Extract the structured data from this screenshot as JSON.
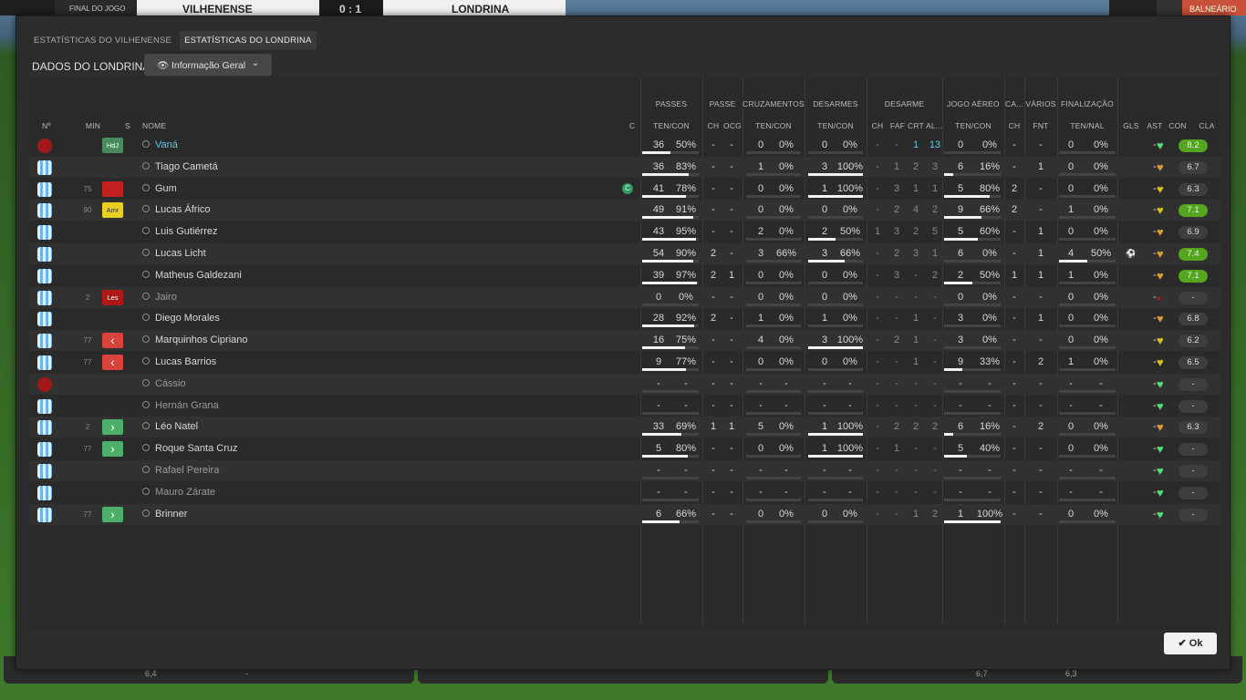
{
  "topbar": {
    "final_label": "FINAL DO JOGO",
    "home": "VILHENENSE",
    "score": "0 : 1",
    "away": "LONDRINA",
    "right_label": "BALNEÁRIO"
  },
  "tabs": [
    {
      "label": "ESTATÍSTICAS DO VILHENENSE",
      "active": false
    },
    {
      "label": "ESTATÍSTICAS DO LONDRINA",
      "active": true
    }
  ],
  "section_title": "DADOS DO LONDRINA",
  "view_dropdown": {
    "value": "Informação Geral",
    "icon": "eye-icon"
  },
  "group_headers": [
    "PASSES",
    "PASSE",
    "CRUZAMENTOS",
    "DESARMES",
    "DESARME",
    "JOGO AÉREO",
    "CA...",
    "VÁRIOS",
    "FINALIZAÇÃO"
  ],
  "columns": [
    "Nº",
    "MIN",
    "S",
    "NOME",
    "C",
    "TEN/CON",
    "CH",
    "OCG",
    "TEN/CON",
    "TEN/CON",
    "CH",
    "FAF",
    "CRT",
    "AL...",
    "TEN/CON",
    "CH",
    "FNT",
    "TEN/NAL",
    "GLS",
    "AST",
    "CON",
    "CLA"
  ],
  "players": [
    {
      "shirt": "red",
      "min": "",
      "status": "HdJ",
      "status_color": "#4a8a5c",
      "name": "Vaná",
      "captain": false,
      "pass": [
        "36",
        "50%"
      ],
      "passe": [
        "-",
        "-"
      ],
      "cruz": [
        "0",
        "0%"
      ],
      "des": [
        "0",
        "0%"
      ],
      "desarme": [
        "-",
        "-",
        "1",
        "13"
      ],
      "aereo": [
        "0",
        "0%"
      ],
      "ca": "-",
      "fnt": "-",
      "fin": [
        "0",
        "0%"
      ],
      "gls": "",
      "ast": "-",
      "heart": "green",
      "rating": "8.2",
      "good": true,
      "pbar": 50,
      "dbar": 0,
      "abar": 0,
      "fbar": 0
    },
    {
      "shirt": "blue",
      "min": "",
      "status": "",
      "status_color": "",
      "name": "Tiago Cametá",
      "captain": false,
      "pass": [
        "36",
        "83%"
      ],
      "passe": [
        "-",
        "-"
      ],
      "cruz": [
        "1",
        "0%"
      ],
      "des": [
        "3",
        "100%"
      ],
      "desarme": [
        "-",
        "1",
        "2",
        "3"
      ],
      "aereo": [
        "6",
        "16%"
      ],
      "ca": "-",
      "fnt": "1",
      "fin": [
        "0",
        "0%"
      ],
      "gls": "",
      "ast": "-",
      "heart": "orange",
      "rating": "6.7",
      "good": false,
      "pbar": 83,
      "dbar": 100,
      "abar": 16,
      "fbar": 0
    },
    {
      "shirt": "blue",
      "min": "75",
      "status": "",
      "status_color": "#c02020",
      "name": "Gum",
      "captain": true,
      "pass": [
        "41",
        "78%"
      ],
      "passe": [
        "-",
        "-"
      ],
      "cruz": [
        "0",
        "0%"
      ],
      "des": [
        "1",
        "100%"
      ],
      "desarme": [
        "-",
        "3",
        "1",
        "1"
      ],
      "aereo": [
        "5",
        "80%"
      ],
      "ca": "2",
      "fnt": "-",
      "fin": [
        "0",
        "0%"
      ],
      "gls": "",
      "ast": "-",
      "heart": "yellow",
      "rating": "6.3",
      "good": false,
      "pbar": 78,
      "dbar": 100,
      "abar": 80,
      "fbar": 0
    },
    {
      "shirt": "blue",
      "min": "90",
      "status": "Amr",
      "status_color": "#e8d020",
      "name": "Lucas Áfrico",
      "captain": false,
      "pass": [
        "49",
        "91%"
      ],
      "passe": [
        "-",
        "-"
      ],
      "cruz": [
        "0",
        "0%"
      ],
      "des": [
        "0",
        "0%"
      ],
      "desarme": [
        "-",
        "2",
        "4",
        "2"
      ],
      "aereo": [
        "9",
        "66%"
      ],
      "ca": "2",
      "fnt": "-",
      "fin": [
        "1",
        "0%"
      ],
      "gls": "",
      "ast": "-",
      "heart": "yellow",
      "rating": "7.1",
      "good": true,
      "pbar": 91,
      "dbar": 0,
      "abar": 66,
      "fbar": 0
    },
    {
      "shirt": "blue",
      "min": "",
      "status": "",
      "status_color": "",
      "name": "Luis Gutiérrez",
      "captain": false,
      "pass": [
        "43",
        "95%"
      ],
      "passe": [
        "-",
        "-"
      ],
      "cruz": [
        "2",
        "0%"
      ],
      "des": [
        "2",
        "50%"
      ],
      "desarme": [
        "1",
        "3",
        "2",
        "5"
      ],
      "aereo": [
        "5",
        "60%"
      ],
      "ca": "-",
      "fnt": "1",
      "fin": [
        "0",
        "0%"
      ],
      "gls": "",
      "ast": "-",
      "heart": "orange",
      "rating": "6.9",
      "good": false,
      "pbar": 95,
      "dbar": 50,
      "abar": 60,
      "fbar": 0
    },
    {
      "shirt": "blue",
      "min": "",
      "status": "",
      "status_color": "",
      "name": "Lucas Licht",
      "captain": false,
      "pass": [
        "54",
        "90%"
      ],
      "passe": [
        "2",
        "-"
      ],
      "cruz": [
        "3",
        "66%"
      ],
      "des": [
        "3",
        "66%"
      ],
      "desarme": [
        "-",
        "2",
        "3",
        "1"
      ],
      "aereo": [
        "6",
        "0%"
      ],
      "ca": "-",
      "fnt": "1",
      "fin": [
        "4",
        "50%"
      ],
      "gls": "ball",
      "ast": "-",
      "heart": "orange",
      "rating": "7.4",
      "good": true,
      "pbar": 90,
      "dbar": 66,
      "abar": 0,
      "fbar": 50
    },
    {
      "shirt": "blue",
      "min": "",
      "status": "",
      "status_color": "",
      "name": "Matheus Galdezani",
      "captain": false,
      "pass": [
        "39",
        "97%"
      ],
      "passe": [
        "2",
        "1"
      ],
      "cruz": [
        "0",
        "0%"
      ],
      "des": [
        "0",
        "0%"
      ],
      "desarme": [
        "-",
        "3",
        "-",
        "2"
      ],
      "aereo": [
        "2",
        "50%"
      ],
      "ca": "1",
      "fnt": "1",
      "fin": [
        "1",
        "0%"
      ],
      "gls": "",
      "ast": "-",
      "heart": "orange",
      "rating": "7.1",
      "good": true,
      "pbar": 97,
      "dbar": 0,
      "abar": 50,
      "fbar": 0
    },
    {
      "shirt": "blue",
      "min": "2",
      "status": "Les",
      "status_color": "#b01818",
      "name": "Jairo",
      "captain": false,
      "pass": [
        "0",
        "0%"
      ],
      "passe": [
        "-",
        "-"
      ],
      "cruz": [
        "0",
        "0%"
      ],
      "des": [
        "0",
        "0%"
      ],
      "desarme": [
        "-",
        "-",
        "-",
        "-"
      ],
      "aereo": [
        "0",
        "0%"
      ],
      "ca": "-",
      "fnt": "-",
      "fin": [
        "0",
        "0%"
      ],
      "gls": "",
      "ast": "-",
      "heart": "red",
      "rating": "-",
      "good": false,
      "pbar": 0,
      "dbar": 0,
      "abar": 0,
      "fbar": 0
    },
    {
      "shirt": "blue",
      "min": "",
      "status": "",
      "status_color": "",
      "name": "Diego Morales",
      "captain": false,
      "pass": [
        "28",
        "92%"
      ],
      "passe": [
        "2",
        "-"
      ],
      "cruz": [
        "1",
        "0%"
      ],
      "des": [
        "1",
        "0%"
      ],
      "desarme": [
        "-",
        "-",
        "1",
        "-"
      ],
      "aereo": [
        "3",
        "0%"
      ],
      "ca": "-",
      "fnt": "1",
      "fin": [
        "0",
        "0%"
      ],
      "gls": "",
      "ast": "-",
      "heart": "orange",
      "rating": "6.8",
      "good": false,
      "pbar": 92,
      "dbar": 0,
      "abar": 0,
      "fbar": 0
    },
    {
      "shirt": "blue",
      "min": "77",
      "status": "out",
      "status_color": "#d9433e",
      "name": "Marquinhos Cipriano",
      "captain": false,
      "pass": [
        "16",
        "75%"
      ],
      "passe": [
        "-",
        "-"
      ],
      "cruz": [
        "4",
        "0%"
      ],
      "des": [
        "3",
        "100%"
      ],
      "desarme": [
        "-",
        "2",
        "1",
        "-"
      ],
      "aereo": [
        "3",
        "0%"
      ],
      "ca": "-",
      "fnt": "-",
      "fin": [
        "0",
        "0%"
      ],
      "gls": "",
      "ast": "-",
      "heart": "yellow",
      "rating": "6.2",
      "good": false,
      "pbar": 75,
      "dbar": 100,
      "abar": 0,
      "fbar": 0
    },
    {
      "shirt": "blue",
      "min": "77",
      "status": "out",
      "status_color": "#d9433e",
      "name": "Lucas Barrios",
      "captain": false,
      "pass": [
        "9",
        "77%"
      ],
      "passe": [
        "-",
        "-"
      ],
      "cruz": [
        "0",
        "0%"
      ],
      "des": [
        "0",
        "0%"
      ],
      "desarme": [
        "-",
        "-",
        "1",
        "-"
      ],
      "aereo": [
        "9",
        "33%"
      ],
      "ca": "-",
      "fnt": "2",
      "fin": [
        "1",
        "0%"
      ],
      "gls": "",
      "ast": "-",
      "heart": "yellow",
      "rating": "6.5",
      "good": false,
      "pbar": 77,
      "dbar": 0,
      "abar": 33,
      "fbar": 0
    },
    {
      "shirt": "red",
      "min": "",
      "status": "",
      "status_color": "",
      "name": "Cássio",
      "captain": false,
      "pass": [
        "-",
        "-"
      ],
      "passe": [
        "-",
        "-"
      ],
      "cruz": [
        "-",
        "-"
      ],
      "des": [
        "-",
        "-"
      ],
      "desarme": [
        "-",
        "-",
        "-",
        "-"
      ],
      "aereo": [
        "-",
        "-"
      ],
      "ca": "-",
      "fnt": "-",
      "fin": [
        "-",
        "-"
      ],
      "gls": "",
      "ast": "-",
      "heart": "green",
      "rating": "-",
      "good": false,
      "pbar": 0,
      "dbar": 0,
      "abar": 0,
      "fbar": 0
    },
    {
      "shirt": "blue",
      "min": "",
      "status": "",
      "status_color": "",
      "name": "Hernán Grana",
      "captain": false,
      "pass": [
        "-",
        "-"
      ],
      "passe": [
        "-",
        "-"
      ],
      "cruz": [
        "-",
        "-"
      ],
      "des": [
        "-",
        "-"
      ],
      "desarme": [
        "-",
        "-",
        "-",
        "-"
      ],
      "aereo": [
        "-",
        "-"
      ],
      "ca": "-",
      "fnt": "-",
      "fin": [
        "-",
        "-"
      ],
      "gls": "",
      "ast": "-",
      "heart": "green",
      "rating": "-",
      "good": false,
      "pbar": 0,
      "dbar": 0,
      "abar": 0,
      "fbar": 0
    },
    {
      "shirt": "blue",
      "min": "2",
      "status": "in",
      "status_color": "#4caf6a",
      "name": "Léo Natel",
      "captain": false,
      "pass": [
        "33",
        "69%"
      ],
      "passe": [
        "1",
        "1"
      ],
      "cruz": [
        "5",
        "0%"
      ],
      "des": [
        "1",
        "100%"
      ],
      "desarme": [
        "-",
        "2",
        "2",
        "2"
      ],
      "aereo": [
        "6",
        "16%"
      ],
      "ca": "-",
      "fnt": "2",
      "fin": [
        "0",
        "0%"
      ],
      "gls": "",
      "ast": "-",
      "heart": "orange",
      "rating": "6.3",
      "good": false,
      "pbar": 69,
      "dbar": 100,
      "abar": 16,
      "fbar": 0
    },
    {
      "shirt": "blue",
      "min": "77",
      "status": "in",
      "status_color": "#4caf6a",
      "name": "Roque Santa Cruz",
      "captain": false,
      "pass": [
        "5",
        "80%"
      ],
      "passe": [
        "-",
        "-"
      ],
      "cruz": [
        "0",
        "0%"
      ],
      "des": [
        "1",
        "100%"
      ],
      "desarme": [
        "-",
        "1",
        "-",
        "-"
      ],
      "aereo": [
        "5",
        "40%"
      ],
      "ca": "-",
      "fnt": "-",
      "fin": [
        "0",
        "0%"
      ],
      "gls": "",
      "ast": "-",
      "heart": "green",
      "rating": "-",
      "good": false,
      "pbar": 80,
      "dbar": 100,
      "abar": 40,
      "fbar": 0
    },
    {
      "shirt": "blue",
      "min": "",
      "status": "",
      "status_color": "",
      "name": "Rafael Pereira",
      "captain": false,
      "pass": [
        "-",
        "-"
      ],
      "passe": [
        "-",
        "-"
      ],
      "cruz": [
        "-",
        "-"
      ],
      "des": [
        "-",
        "-"
      ],
      "desarme": [
        "-",
        "-",
        "-",
        "-"
      ],
      "aereo": [
        "-",
        "-"
      ],
      "ca": "-",
      "fnt": "-",
      "fin": [
        "-",
        "-"
      ],
      "gls": "",
      "ast": "-",
      "heart": "green",
      "rating": "-",
      "good": false,
      "pbar": 0,
      "dbar": 0,
      "abar": 0,
      "fbar": 0
    },
    {
      "shirt": "blue",
      "min": "",
      "status": "",
      "status_color": "",
      "name": "Mauro Zárate",
      "captain": false,
      "pass": [
        "-",
        "-"
      ],
      "passe": [
        "-",
        "-"
      ],
      "cruz": [
        "-",
        "-"
      ],
      "des": [
        "-",
        "-"
      ],
      "desarme": [
        "-",
        "-",
        "-",
        "-"
      ],
      "aereo": [
        "-",
        "-"
      ],
      "ca": "-",
      "fnt": "-",
      "fin": [
        "-",
        "-"
      ],
      "gls": "",
      "ast": "-",
      "heart": "green",
      "rating": "-",
      "good": false,
      "pbar": 0,
      "dbar": 0,
      "abar": 0,
      "fbar": 0
    },
    {
      "shirt": "blue",
      "min": "77",
      "status": "in",
      "status_color": "#4caf6a",
      "name": "Brinner",
      "captain": false,
      "pass": [
        "6",
        "66%"
      ],
      "passe": [
        "-",
        "-"
      ],
      "cruz": [
        "0",
        "0%"
      ],
      "des": [
        "0",
        "0%"
      ],
      "desarme": [
        "-",
        "-",
        "1",
        "2"
      ],
      "aereo": [
        "1",
        "100%"
      ],
      "ca": "-",
      "fnt": "-",
      "fin": [
        "0",
        "0%"
      ],
      "gls": "",
      "ast": "-",
      "heart": "green",
      "rating": "-",
      "good": false,
      "pbar": 66,
      "dbar": 0,
      "abar": 100,
      "fbar": 0
    }
  ],
  "ok_label": "Ok",
  "bottom": {
    "left_a": "6,4",
    "left_b": "-",
    "right_a": "6,7",
    "right_b": "6,3"
  }
}
